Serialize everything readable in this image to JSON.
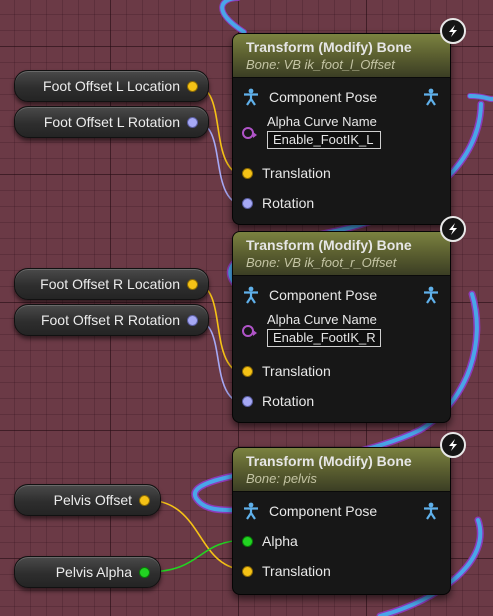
{
  "getters": {
    "foot_offset_l_location": "Foot Offset L Location",
    "foot_offset_l_rotation": "Foot Offset L Rotation",
    "foot_offset_r_location": "Foot Offset R Location",
    "foot_offset_r_rotation": "Foot Offset R Rotation",
    "pelvis_offset": "Pelvis Offset",
    "pelvis_alpha": "Pelvis Alpha"
  },
  "nodes": [
    {
      "title": "Transform (Modify) Bone",
      "subtitle": "Bone: VB ik_foot_l_Offset",
      "component_pose": "Component Pose",
      "alpha_curve_name": "Alpha Curve Name",
      "alpha_curve_value": "Enable_FootIK_L",
      "translation": "Translation",
      "rotation": "Rotation"
    },
    {
      "title": "Transform (Modify) Bone",
      "subtitle": "Bone: VB ik_foot_r_Offset",
      "component_pose": "Component Pose",
      "alpha_curve_name": "Alpha Curve Name",
      "alpha_curve_value": "Enable_FootIK_R",
      "translation": "Translation",
      "rotation": "Rotation"
    },
    {
      "title": "Transform (Modify) Bone",
      "subtitle": "Bone: pelvis",
      "component_pose": "Component Pose",
      "alpha": "Alpha",
      "translation": "Translation"
    }
  ],
  "colors": {
    "background": "#6b3a46",
    "vector_pin": "#f5c216",
    "rotator_pin": "#a6a9f5",
    "float_pin": "#22d322",
    "pose_wire": "#4aa6e8",
    "name_pin": "#b054c8",
    "node_header": "#6e7438"
  },
  "icons": {
    "pose": "pose-person-icon",
    "dynamics": "lightning-bolt-icon"
  }
}
